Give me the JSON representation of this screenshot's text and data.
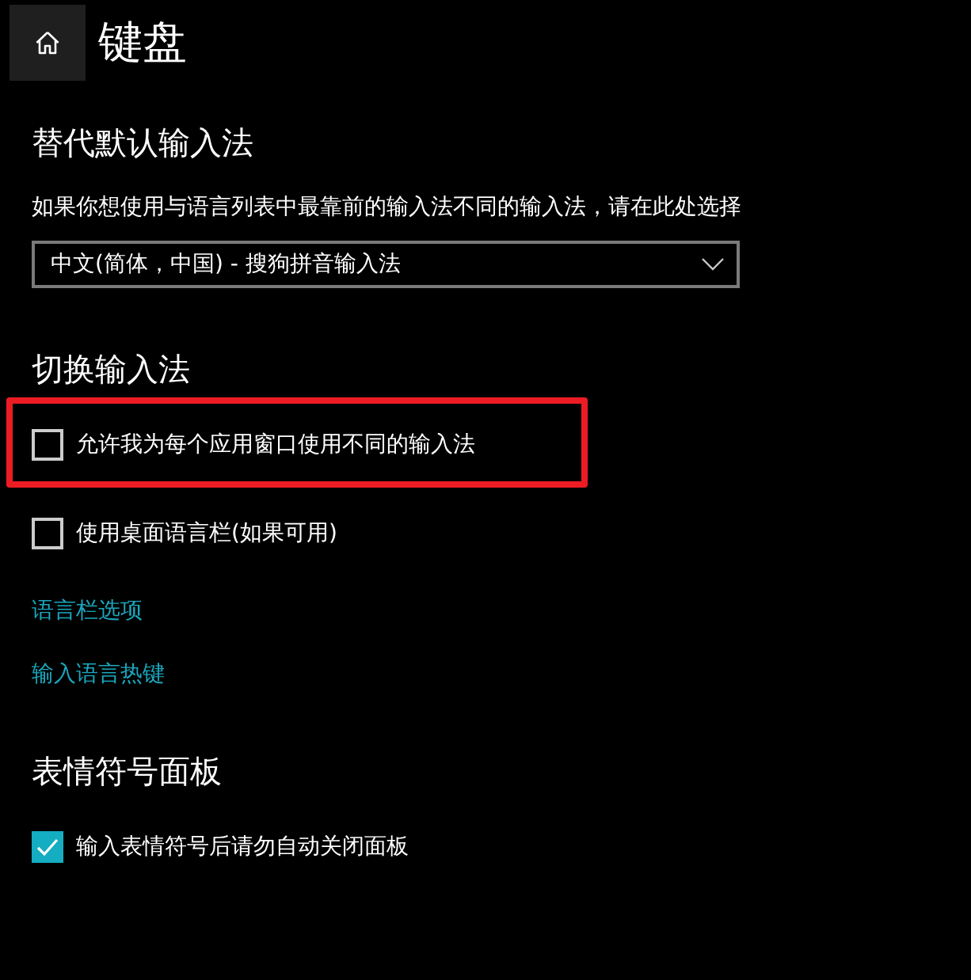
{
  "header": {
    "title": "键盘"
  },
  "sections": [
    {
      "heading": "替代默认输入法",
      "items": [
        {
          "kind": "description",
          "text": "如果你想使用与语言列表中最靠前的输入法不同的输入法，请在此处选择"
        },
        {
          "kind": "dropdown",
          "value": "中文(简体，中国) - 搜狗拼音输入法"
        }
      ]
    },
    {
      "heading": "切换输入法",
      "items": [
        {
          "kind": "checkbox",
          "label": "允许我为每个应用窗口使用不同的输入法",
          "checked": false,
          "highlighted": true
        },
        {
          "kind": "checkbox",
          "label": "使用桌面语言栏(如果可用)",
          "checked": false,
          "highlighted": false
        },
        {
          "kind": "link",
          "text": "语言栏选项"
        },
        {
          "kind": "link",
          "text": "输入语言热键"
        }
      ]
    },
    {
      "heading": "表情符号面板",
      "items": [
        {
          "kind": "checkbox",
          "label": "输入表情符号后请勿自动关闭面板",
          "checked": true,
          "highlighted": false
        }
      ]
    }
  ]
}
